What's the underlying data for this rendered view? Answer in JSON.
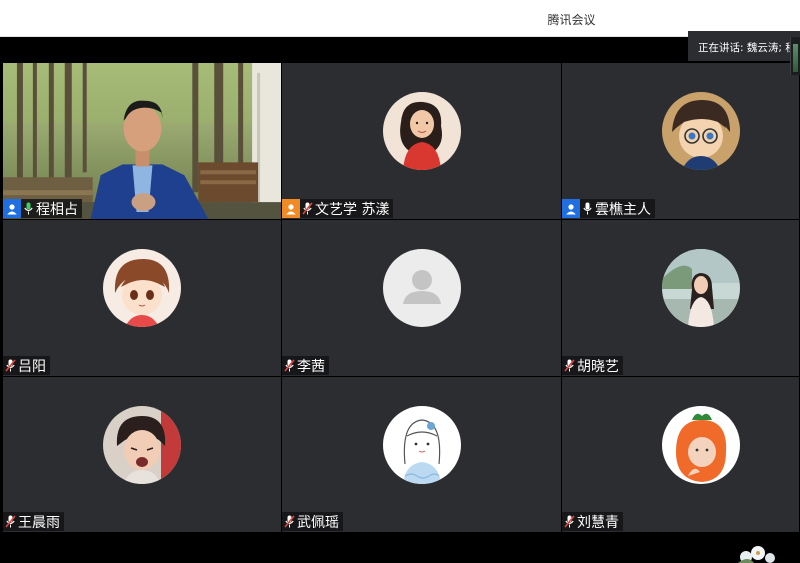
{
  "app": {
    "title": "腾讯会议"
  },
  "status": {
    "speaking_text": "正在讲话: 魏云涛; 程"
  },
  "participants": [
    {
      "name": "程相占",
      "role": "host",
      "mic": "on",
      "avatar": "video-person",
      "icons": [
        "person-icon",
        "mic-on-icon"
      ]
    },
    {
      "name": "文艺学 苏漾",
      "role": "cohost",
      "mic": "muted",
      "avatar": "illustrated-girl-red-dress",
      "icons": [
        "person-icon",
        "mic-muted-icon"
      ]
    },
    {
      "name": "雲樵主人",
      "role": "host",
      "mic": "on",
      "avatar": "anime-boy-glasses",
      "icons": [
        "person-icon",
        "mic-on-icon"
      ]
    },
    {
      "name": "吕阳",
      "role": "none",
      "mic": "muted",
      "avatar": "anime-girl-brown-hair",
      "icons": [
        "mic-muted-icon"
      ]
    },
    {
      "name": "李茜",
      "role": "none",
      "mic": "muted",
      "avatar": "default-user",
      "icons": [
        "mic-muted-icon"
      ]
    },
    {
      "name": "胡晓艺",
      "role": "none",
      "mic": "muted",
      "avatar": "photo-woman-outdoors",
      "icons": [
        "mic-muted-icon"
      ]
    },
    {
      "name": "王晨雨",
      "role": "none",
      "mic": "muted",
      "avatar": "photo-child",
      "icons": [
        "mic-muted-icon"
      ]
    },
    {
      "name": "武佩瑶",
      "role": "none",
      "mic": "muted",
      "avatar": "sketch-girl",
      "icons": [
        "mic-muted-icon"
      ]
    },
    {
      "name": "刘慧青",
      "role": "none",
      "mic": "muted",
      "avatar": "orange-costume-child",
      "icons": [
        "mic-muted-icon"
      ]
    }
  ],
  "colors": {
    "tile_bg": "#2b2d30",
    "host_badge": "#1f6fe0",
    "cohost_badge": "#f08a24",
    "muted_red": "#e0463b"
  }
}
